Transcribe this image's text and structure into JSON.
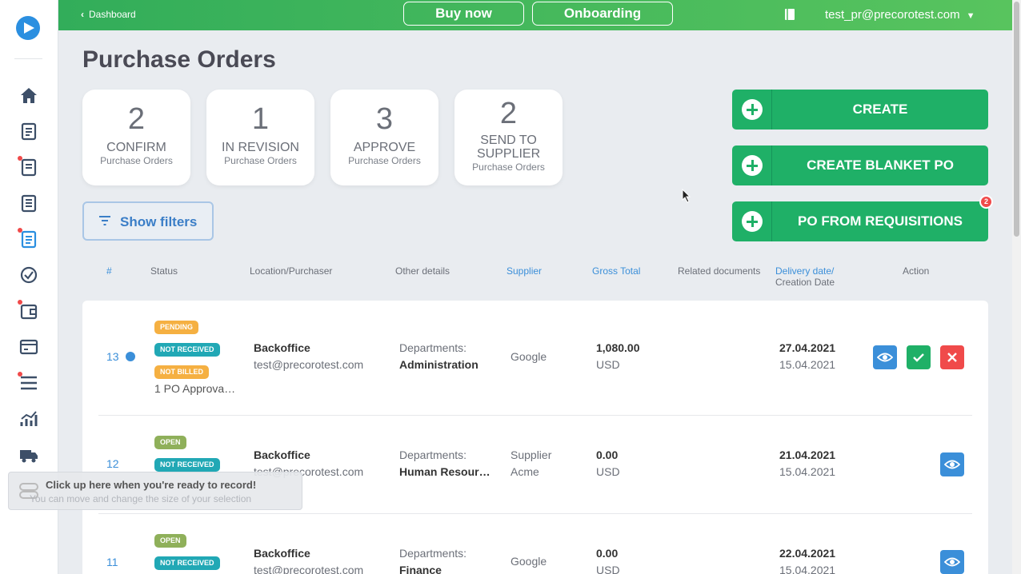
{
  "topbar": {
    "back_label": "Dashboard",
    "buy_now": "Buy now",
    "onboarding": "Onboarding",
    "user_email": "test_pr@precorotest.com"
  },
  "page": {
    "title": "Purchase Orders"
  },
  "stats": [
    {
      "count": "2",
      "label": "CONFIRM",
      "sub": "Purchase Orders"
    },
    {
      "count": "1",
      "label": "IN REVISION",
      "sub": "Purchase Orders"
    },
    {
      "count": "3",
      "label": "APPROVE",
      "sub": "Purchase Orders"
    },
    {
      "count": "2",
      "label": "SEND TO SUPPLIER",
      "sub": "Purchase Orders"
    }
  ],
  "actions": {
    "create": "CREATE",
    "create_blanket": "CREATE BLANKET PO",
    "from_requisitions": "PO FROM REQUISITIONS",
    "from_requisitions_badge": "2"
  },
  "filters": {
    "label": "Show filters"
  },
  "table": {
    "headers": {
      "num": "#",
      "status": "Status",
      "location": "Location/Purchaser",
      "other": "Other details",
      "supplier": "Supplier",
      "gross": "Gross Total",
      "related": "Related documents",
      "delivery": "Delivery date/",
      "creation": "Creation Date",
      "action": "Action"
    },
    "rows": [
      {
        "num": "13",
        "tags": [
          "PENDING",
          "NOT RECEIVED",
          "NOT BILLED"
        ],
        "approvals": "1 PO Approva…",
        "location": "Backoffice",
        "purchaser": "test@precorotest.com",
        "dept_label": "Departments:",
        "dept": "Administration",
        "supplier": "Google",
        "total": "1,080.00",
        "currency": "USD",
        "delivery": "27.04.2021",
        "created": "15.04.2021"
      },
      {
        "num": "12",
        "tags": [
          "OPEN",
          "NOT RECEIVED"
        ],
        "location": "Backoffice",
        "purchaser": "test@precorotest.com",
        "dept_label": "Departments:",
        "dept": "Human Resour…",
        "supplier": "Supplier",
        "supplier2": "Acme",
        "total": "0.00",
        "currency": "USD",
        "delivery": "21.04.2021",
        "created": "15.04.2021"
      },
      {
        "num": "11",
        "tags": [
          "OPEN",
          "NOT RECEIVED"
        ],
        "location": "Backoffice",
        "purchaser": "test@precorotest.com",
        "dept_label": "Departments:",
        "dept": "Finance",
        "supplier": "Google",
        "total": "0.00",
        "currency": "USD",
        "delivery": "22.04.2021",
        "created": "15.04.2021"
      }
    ]
  },
  "recorder": {
    "title": "Click up here when you're ready to record!",
    "subtitle": "You can move and change the size of your selection"
  },
  "colors": {
    "brand_green": "#1fb067",
    "link_blue": "#3b8fd9",
    "danger_red": "#f04a4a"
  }
}
